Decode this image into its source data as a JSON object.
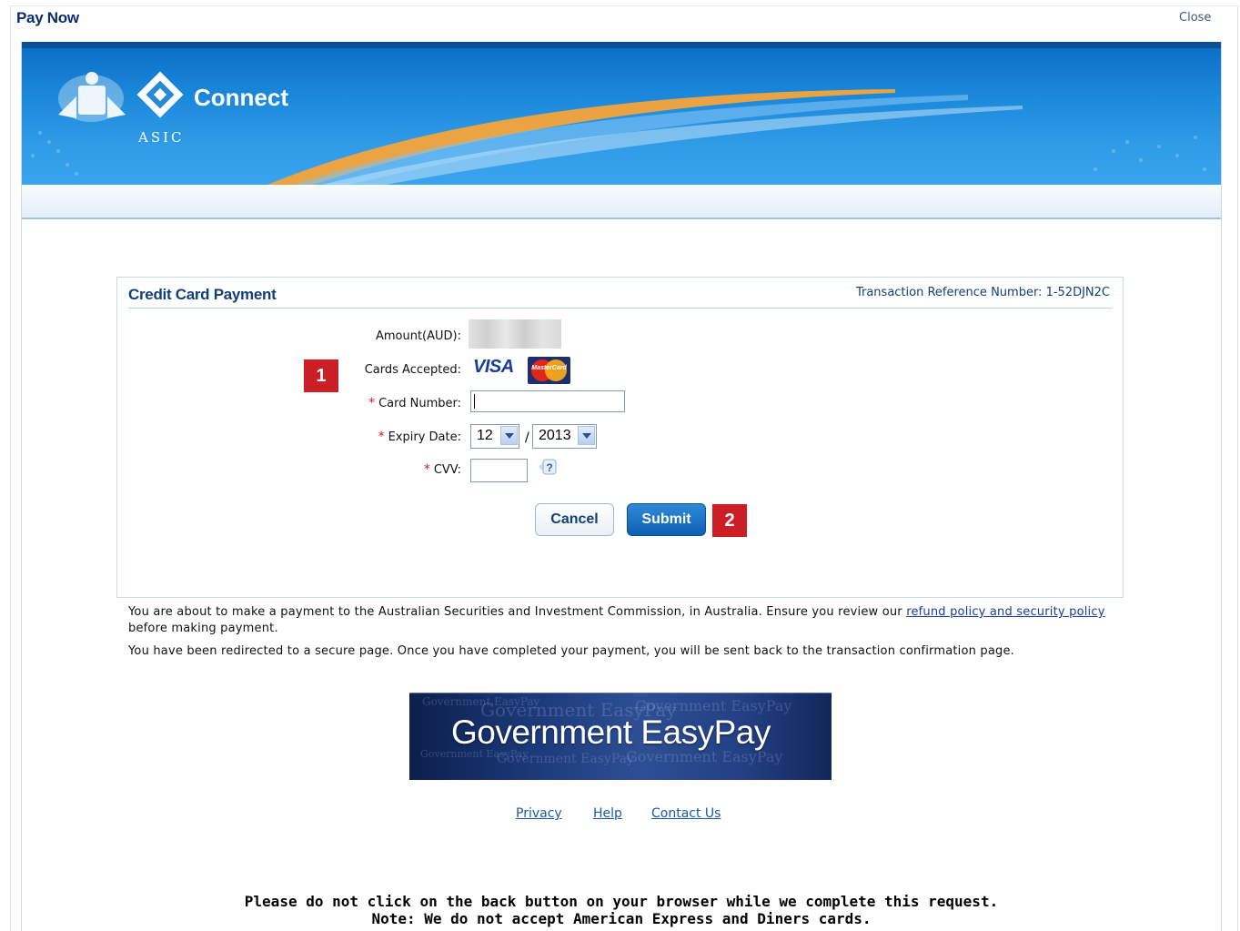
{
  "window": {
    "title": "Pay Now",
    "close_label": "Close"
  },
  "banner": {
    "logo_text": "Connect",
    "org_text": "ASIC"
  },
  "panel": {
    "title": "Credit Card Payment",
    "reference": "Transaction Reference Number: 1-52DJN2C"
  },
  "form": {
    "amount_label": "Amount(AUD):",
    "cards_label": "Cards Accepted:",
    "visa_text": "VISA",
    "mastercard_text": "MasterCard",
    "card_number_label": "Card Number:",
    "card_number_value": "",
    "expiry_label": "Expiry Date:",
    "expiry_month": "12",
    "expiry_separator": "/",
    "expiry_year": "2013",
    "cvv_label": "CVV:",
    "cvv_value": "",
    "required_marker": "*",
    "help_icon_text": "?",
    "cancel_label": "Cancel",
    "submit_label": "Submit"
  },
  "markers": {
    "one": "1",
    "two": "2"
  },
  "info": {
    "line1_text": "You are about to make a payment to the Australian Securities and Investment Commission, in Australia. Ensure you review our ",
    "line1_link": "refund policy and security policy",
    "line1_suffix": " before making payment.",
    "line2_text": "You have been redirected to a secure page. Once you have completed your payment, you will be sent back to the transaction confirmation page."
  },
  "easypay": {
    "label": "Government EasyPay"
  },
  "footer": {
    "privacy": "Privacy",
    "help": "Help",
    "contact": "Contact Us"
  },
  "notes": {
    "line1": "Please do not click on the back button on your browser while we complete this request.",
    "line2": "Note: We do not accept American Express and Diners cards."
  },
  "colors": {
    "accent": "#123f78",
    "marker": "#cc1f25",
    "submit": "#0e5fb3"
  }
}
